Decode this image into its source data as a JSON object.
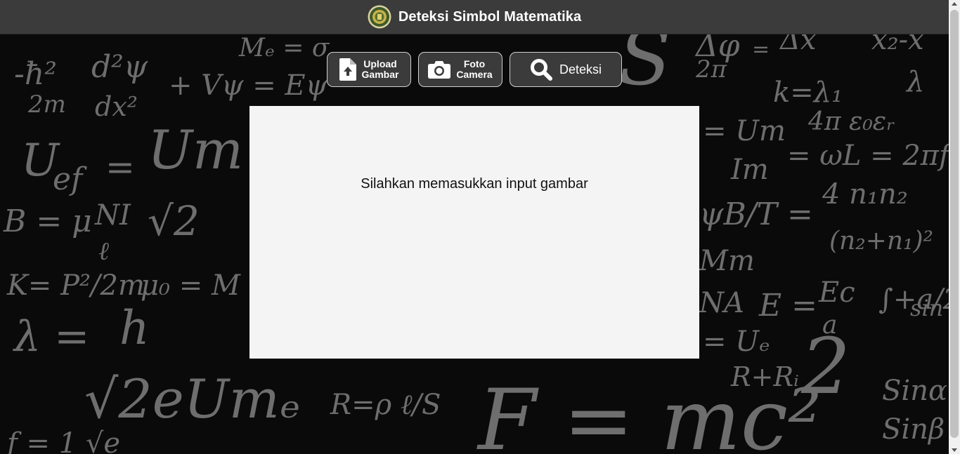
{
  "header": {
    "title": "Deteksi Simbol Matematika",
    "logo_icon": "university-seal-icon"
  },
  "toolbar": {
    "upload": {
      "line1": "Upload",
      "line2": "Gambar",
      "icon": "file-upload-icon"
    },
    "camera": {
      "line1": "Foto",
      "line2": "Camera",
      "icon": "camera-icon"
    },
    "detect": {
      "label": "Deteksi",
      "icon": "search-icon"
    }
  },
  "panel": {
    "message": "Silahkan memasukkan input gambar"
  },
  "colors": {
    "header_bg": "#3b3b3b",
    "button_bg": "#3b3b3b",
    "panel_bg": "#f4f4f4"
  }
}
